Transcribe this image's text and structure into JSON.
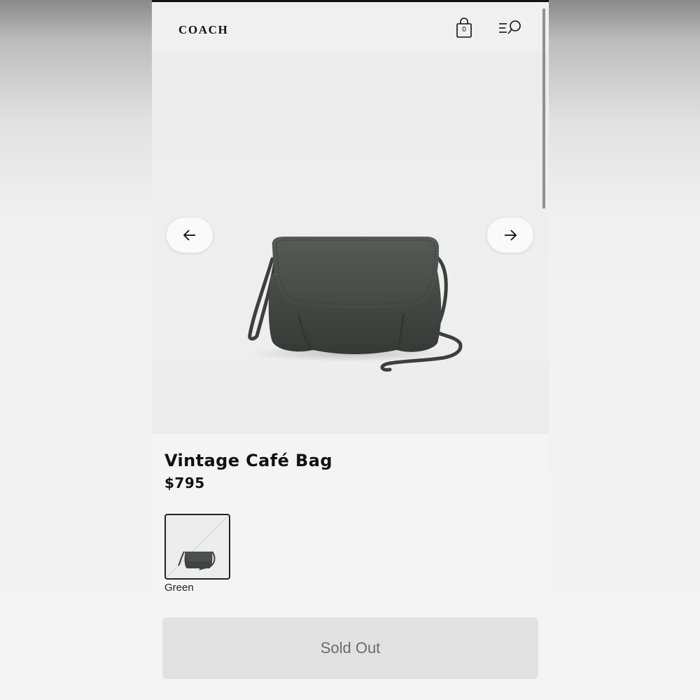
{
  "header": {
    "logo": "COACH",
    "cart_count": "0",
    "cart_icon": "shopping-bag-icon",
    "menu_icon": "menu-search-icon"
  },
  "gallery": {
    "prev_icon": "arrow-left-icon",
    "next_icon": "arrow-right-icon",
    "image": "green leather crossbody flap bag"
  },
  "product": {
    "title": "Vintage Café Bag",
    "price": "$795"
  },
  "colors": {
    "selected": "Green",
    "swatch_color": "#3f4440"
  },
  "cta": {
    "label": "Sold Out"
  }
}
